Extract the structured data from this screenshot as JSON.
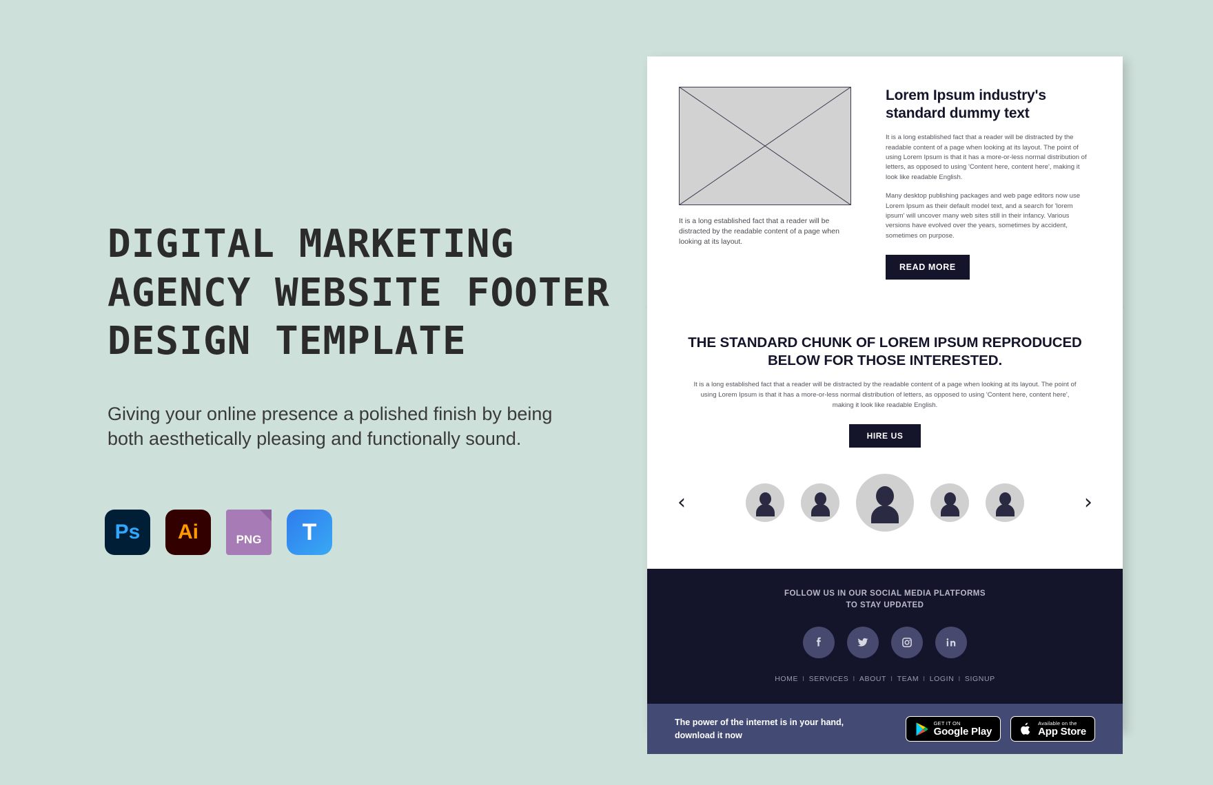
{
  "background_color": "#cee0da",
  "promo": {
    "title": "DIGITAL MARKETING\nAGENCY WEBSITE FOOTER\nDESIGN TEMPLATE",
    "subtitle": "Giving your online presence a polished finish by being both aesthetically pleasing and functionally sound.",
    "formats": [
      {
        "label": "Ps",
        "name": "photoshop-format-icon",
        "color": "#001e36"
      },
      {
        "label": "Ai",
        "name": "illustrator-format-icon",
        "color": "#330000"
      },
      {
        "label": "PNG",
        "name": "png-format-icon",
        "color": "#a77bb5"
      },
      {
        "label": "T",
        "name": "template-format-icon",
        "color": "#2f7ced"
      }
    ]
  },
  "mockup": {
    "hero": {
      "image_placeholder_alt": "image-placeholder",
      "caption": "It is a long established fact that a reader will be distracted by the readable content of a page when looking at its layout.",
      "heading": "Lorem Ipsum industry's standard dummy text",
      "paragraph1": "It is a long established fact that a reader will be distracted by the readable content of a page when looking at its layout. The point of using Lorem Ipsum is that it has a more-or-less normal distribution of letters, as opposed to using 'Content here, content here', making it look like readable English.",
      "paragraph2": "Many desktop publishing packages and web page editors now use Lorem Ipsum as their default model text, and a search for 'lorem ipsum' will uncover many web sites still in their infancy. Various versions have evolved over the years, sometimes by accident, sometimes on purpose.",
      "cta_label": "READ MORE"
    },
    "mid": {
      "heading": "THE STANDARD CHUNK OF LOREM IPSUM REPRODUCED BELOW FOR THOSE INTERESTED.",
      "paragraph": "It is a long established fact that a reader will be distracted by the readable content of a page when looking at its layout. The point of using Lorem Ipsum is that it has a more-or-less normal distribution of letters,  as opposed to using 'Content here, content here', making it look like readable English.",
      "cta_label": "HIRE US"
    },
    "carousel": {
      "prev_icon": "chevron-left-icon",
      "next_icon": "chevron-right-icon",
      "avatar_count": 5,
      "active_index": 2
    },
    "footer": {
      "follow_line1": "FOLLOW US IN OUR SOCIAL MEDIA PLATFORMS",
      "follow_line2": "TO STAY UPDATED",
      "socials": [
        {
          "name": "facebook-icon",
          "label": "Facebook"
        },
        {
          "name": "twitter-icon",
          "label": "Twitter"
        },
        {
          "name": "instagram-icon",
          "label": "Instagram"
        },
        {
          "name": "linkedin-icon",
          "label": "LinkedIn"
        }
      ],
      "links": [
        "HOME",
        "SERVICES",
        "ABOUT",
        "TEAM",
        "LOGIN",
        "SIGNUP"
      ],
      "separator": "I",
      "background_color": "#14142b"
    },
    "appbar": {
      "text_line1": "The power of the internet is in your hand,",
      "text_line2": "download it now",
      "google_badge": {
        "small": "GET IT ON",
        "large": "Google Play"
      },
      "apple_badge": {
        "small": "Available on the",
        "large": "App Store"
      },
      "background_color": "#434a73"
    }
  }
}
